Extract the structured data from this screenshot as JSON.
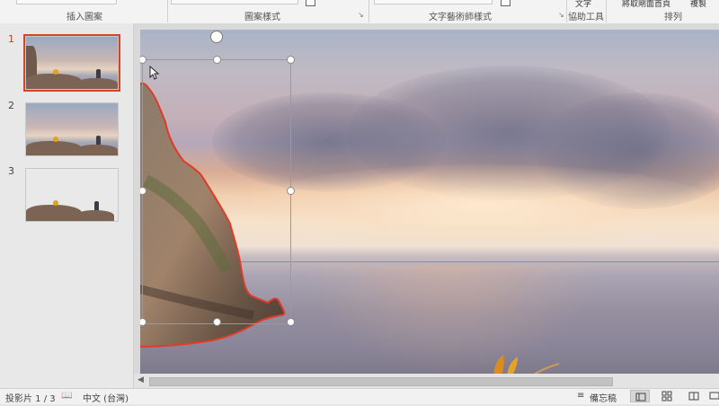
{
  "ribbon": {
    "groups": [
      "插入圖案",
      "圖案樣式",
      "文字藝術師樣式",
      "協助工具",
      "排列"
    ],
    "top_fragments": [
      "文字",
      "將取剛面首頁",
      "複製"
    ]
  },
  "thumbnails": {
    "slides": [
      {
        "number": "1",
        "selected": true
      },
      {
        "number": "2",
        "selected": false
      },
      {
        "number": "3",
        "selected": false
      }
    ]
  },
  "canvas": {
    "accent_outline_color": "#e03a2a",
    "selection_color": "#9a9a9a"
  },
  "status": {
    "slide_counter": "投影片 1 / 3",
    "language": "中文 (台灣)",
    "notes_label": "備忘稿",
    "views": [
      "normal-view-icon",
      "slide-sorter-icon",
      "reading-view-icon",
      "slideshow-icon"
    ]
  }
}
